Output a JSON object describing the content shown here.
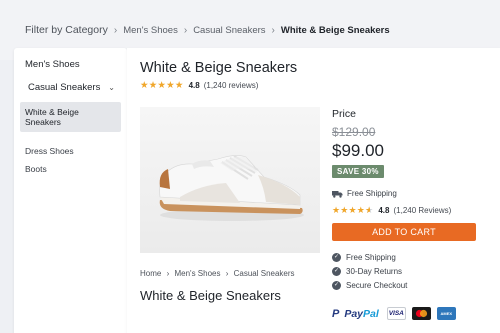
{
  "breadcrumb": {
    "root": "Filter by Category",
    "items": [
      "Men's Shoes",
      "Casual Sneakers",
      "White & Beige Sneakers"
    ]
  },
  "sidebar": {
    "heading": "Men's Shoes",
    "subcategory": "Casual Sneakers",
    "items": [
      "White & Beige Sneakers",
      "Dress Shoes",
      "Boots"
    ]
  },
  "product": {
    "title": "White & Beige Sneakers",
    "rating": "4.8",
    "rating_value": 4.8,
    "reviews": "(1,240 reviews)",
    "image_alt": "white-beige-sneaker"
  },
  "purchase": {
    "price_label": "Price",
    "old_price": "$129.00",
    "new_price": "$99.00",
    "save_badge": "SAVE 30%",
    "shipping": "Free Shipping",
    "rating": "4.8",
    "reviews": "(1,240 Reviews)",
    "cart_label": "ADD TO CART",
    "features": [
      "Free Shipping",
      "30-Day Returns",
      "Secure Checkout"
    ],
    "payments": {
      "paypal_a": "Pay",
      "paypal_b": "Pal",
      "visa": "VISA",
      "amex": "AMEX"
    }
  },
  "lower": {
    "breadcrumb": [
      "Home",
      "Men's Shoes",
      "Casual Sneakers"
    ],
    "title": "White & Beige Sneakers"
  },
  "colors": {
    "accent": "#e86a23",
    "star": "#f0a62a",
    "save_badge": "#6c8b6d"
  }
}
